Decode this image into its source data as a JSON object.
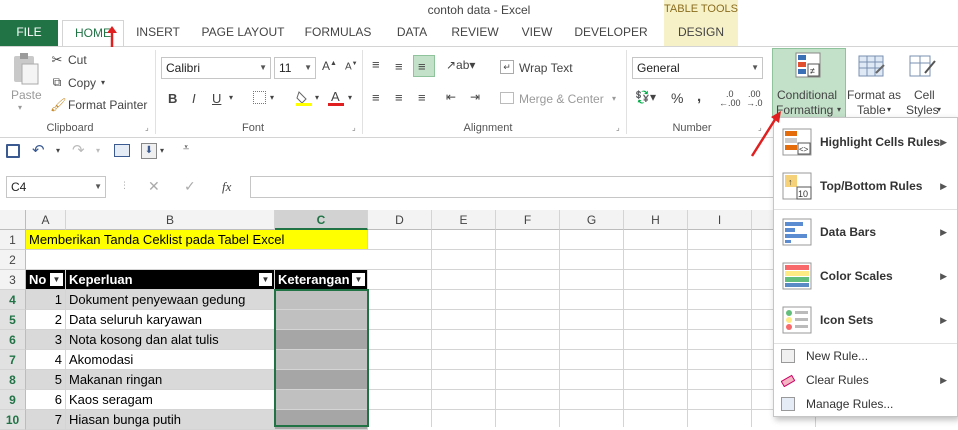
{
  "window": {
    "title": "contoh data - Excel",
    "tab_tools": "TABLE TOOLS"
  },
  "tabs": [
    "FILE",
    "HOME",
    "INSERT",
    "PAGE LAYOUT",
    "FORMULAS",
    "DATA",
    "REVIEW",
    "VIEW",
    "DEVELOPER",
    "DESIGN"
  ],
  "clipboard": {
    "paste": "Paste",
    "cut": "Cut",
    "copy": "Copy",
    "format_painter": "Format Painter",
    "label": "Clipboard"
  },
  "font": {
    "name": "Calibri",
    "size": "11",
    "label": "Font",
    "bold": "B",
    "italic": "I",
    "underline": "U"
  },
  "alignment": {
    "wrap": "Wrap Text",
    "merge": "Merge & Center",
    "label": "Alignment"
  },
  "number": {
    "format": "General",
    "label": "Number",
    "percent": "%"
  },
  "styles": {
    "conditional": [
      "Conditional",
      "Formatting"
    ],
    "format_table": [
      "Format as",
      "Table"
    ],
    "cell_styles": [
      "Cell",
      "Styles"
    ]
  },
  "formula_bar": {
    "name_box": "C4",
    "fx": "fx"
  },
  "columns": [
    "A",
    "B",
    "C",
    "D",
    "E",
    "F",
    "G",
    "H",
    "I"
  ],
  "rows": [
    "1",
    "2",
    "3",
    "4",
    "5",
    "6",
    "7",
    "8",
    "9",
    "10"
  ],
  "sheet": {
    "title_cell": "Memberikan Tanda Ceklist pada Tabel Excel",
    "headers": [
      "No",
      "Keperluan",
      "Keterangan"
    ],
    "data": [
      {
        "no": "1",
        "item": "Dokument penyewaan gedung"
      },
      {
        "no": "2",
        "item": "Data seluruh karyawan"
      },
      {
        "no": "3",
        "item": "Nota kosong dan alat tulis"
      },
      {
        "no": "4",
        "item": "Akomodasi"
      },
      {
        "no": "5",
        "item": "Makanan ringan"
      },
      {
        "no": "6",
        "item": "Kaos seragam"
      },
      {
        "no": "7",
        "item": "Hiasan bunga putih"
      }
    ]
  },
  "menu": {
    "items": [
      "Highlight Cells Rules",
      "Top/Bottom Rules",
      "Data Bars",
      "Color Scales",
      "Icon Sets"
    ],
    "actions": [
      "New Rule...",
      "Clear Rules",
      "Manage Rules..."
    ]
  },
  "colors": {
    "excel_green": "#217346",
    "title_fill": "#ffff00",
    "header_fill": "#000000",
    "selected_fill": "#c0c0c0",
    "alt_row_fill": "#d9d9d9",
    "arrow": "#e02020"
  }
}
